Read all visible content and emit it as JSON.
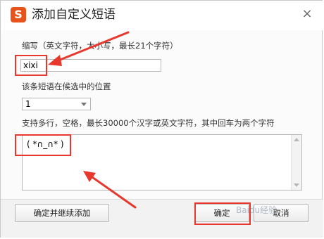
{
  "dialog": {
    "title": "添加自定义短语",
    "logo_letter": "S",
    "close_glyph": "×"
  },
  "abbreviation": {
    "label": "缩写（英文字符，大小写，最长21个字符）",
    "value": "xixi"
  },
  "position": {
    "label": "该条短语在候选中的位置",
    "selected": "1"
  },
  "phrase": {
    "label": "支持多行，空格，最长30000个汉字或英文字符，其中回车为两个字符",
    "value": "( *∩_∩* )"
  },
  "buttons": {
    "confirm_and_continue": "确定并继续添加",
    "confirm": "确定",
    "cancel": "取消"
  },
  "watermark": "Baidu经验",
  "colors": {
    "brand": "#e8531c",
    "highlight": "#e8372c"
  }
}
